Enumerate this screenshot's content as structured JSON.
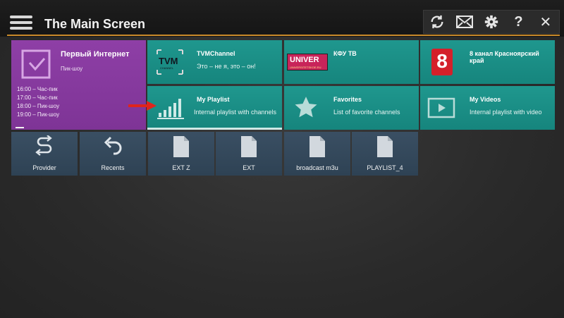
{
  "header": {
    "title": "The Main Screen",
    "icons": [
      "menu-icon",
      "refresh-icon",
      "mail-icon",
      "gear-icon",
      "help-icon",
      "close-icon"
    ],
    "help_glyph": "?",
    "close_glyph": "✕"
  },
  "featured": {
    "title": "Первый Интернет",
    "subtitle": "Пик-шоу",
    "schedule": [
      "16:00 – Час-пик",
      "17:00 – Час-пик",
      "18:00 – Пик-шоу",
      "19:00 – Пик-шоу"
    ]
  },
  "channels": [
    {
      "logo_text": "TVM",
      "logo_sub": "CHANNEL",
      "name": "TVMChannel",
      "subtitle": "Это – не я, это – он!"
    },
    {
      "logo_text": "UNIVER",
      "logo_sub": "UNIVERSITETSKOE.RU",
      "name": "КФУ ТВ",
      "subtitle": ""
    },
    {
      "logo_text": "8",
      "name": "8 канал Красноярский край",
      "subtitle": ""
    }
  ],
  "sections": [
    {
      "name": "My Playlist",
      "subtitle": "Internal playlist with channels",
      "icon": "signal-bars-icon"
    },
    {
      "name": "Favorites",
      "subtitle": "List of favorite channels",
      "icon": "star-icon"
    },
    {
      "name": "My Videos",
      "subtitle": "Internal playlist with video",
      "icon": "video-icon"
    }
  ],
  "bottom_tiles": [
    {
      "label": "Provider",
      "icon": "provider-icon"
    },
    {
      "label": "Recents",
      "icon": "undo-icon"
    },
    {
      "label": "EXT Z",
      "icon": "file-icon"
    },
    {
      "label": "EXT",
      "icon": "file-icon"
    },
    {
      "label": "broadcast m3u",
      "icon": "file-icon"
    },
    {
      "label": "PLAYLIST_4",
      "icon": "file-icon"
    }
  ],
  "colors": {
    "accent_line": "#c98a2a",
    "teal": "#1a8d85",
    "purple": "#8838a0",
    "navy": "#344858"
  }
}
